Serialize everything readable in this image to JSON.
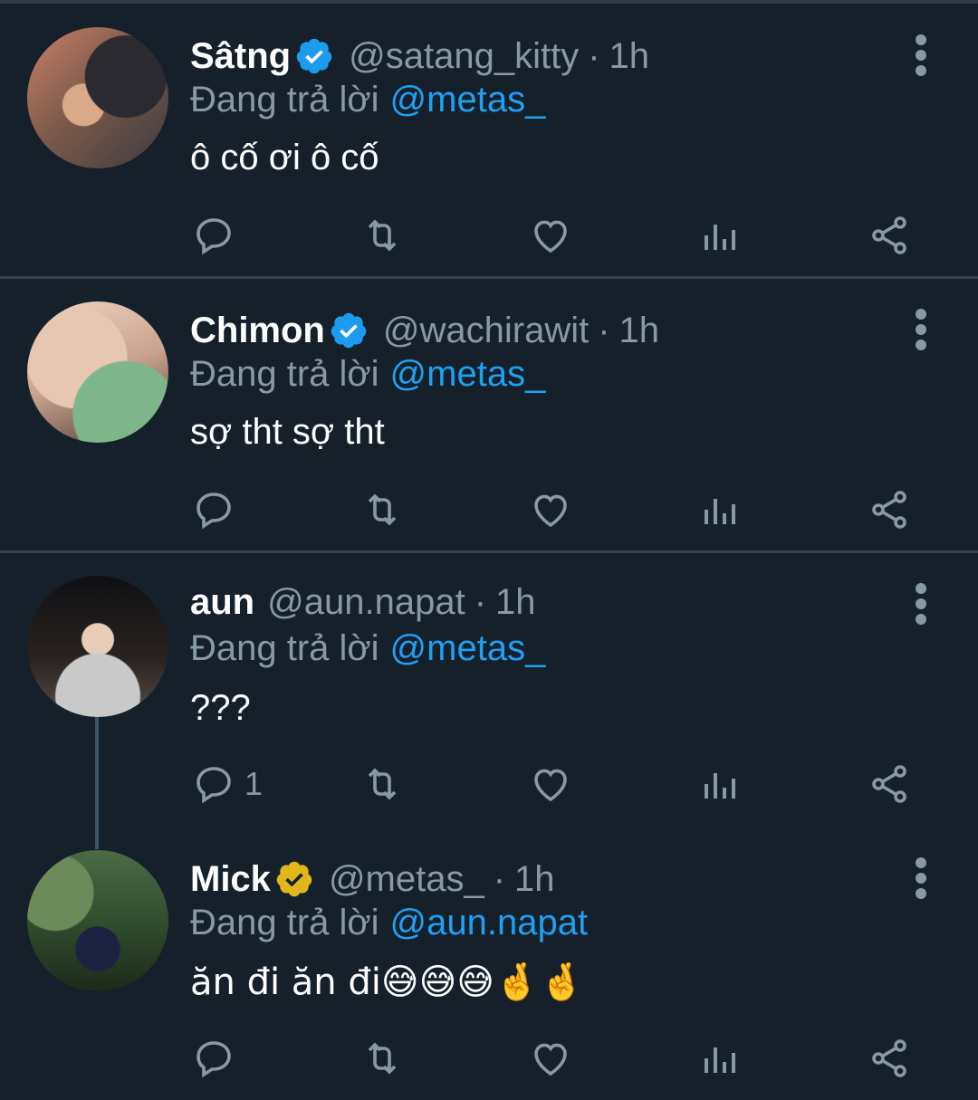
{
  "colors": {
    "background": "#15202b",
    "accent": "#1da1f2",
    "muted": "#8899a6",
    "verified_blue": "#1d9bf0",
    "verified_gold": "#e2b719"
  },
  "tweets": [
    {
      "name": "Sâtng",
      "verified": "blue",
      "handle": "@satang_kitty",
      "time": "1h",
      "reply_prefix": "Đang trả lời",
      "reply_to": "@metas_",
      "text": "ô cố ơi ô cố",
      "reply_count": ""
    },
    {
      "name": "Chimon",
      "verified": "blue",
      "handle": "@wachirawit",
      "time": "1h",
      "reply_prefix": "Đang trả lời",
      "reply_to": "@metas_",
      "text": "sợ tht sợ tht",
      "reply_count": ""
    },
    {
      "name": "aun",
      "verified": "none",
      "handle": "@aun.napat",
      "time": "1h",
      "reply_prefix": "Đang trả lời",
      "reply_to": "@metas_",
      "text": "???",
      "reply_count": "1"
    },
    {
      "name": "Mick",
      "verified": "gold",
      "handle": "@metas_",
      "time": "1h",
      "reply_prefix": "Đang trả lời",
      "reply_to": "@aun.napat",
      "text": "ăn đi ăn đi😅😅😅🤞🤞",
      "reply_count": ""
    }
  ],
  "dot_separator": "·",
  "icons": {
    "reply": "reply-icon",
    "retweet": "retweet-icon",
    "like": "heart-icon",
    "analytics": "analytics-icon",
    "share": "share-icon",
    "more": "more-vertical-icon",
    "verified": "verified-badge-icon"
  }
}
